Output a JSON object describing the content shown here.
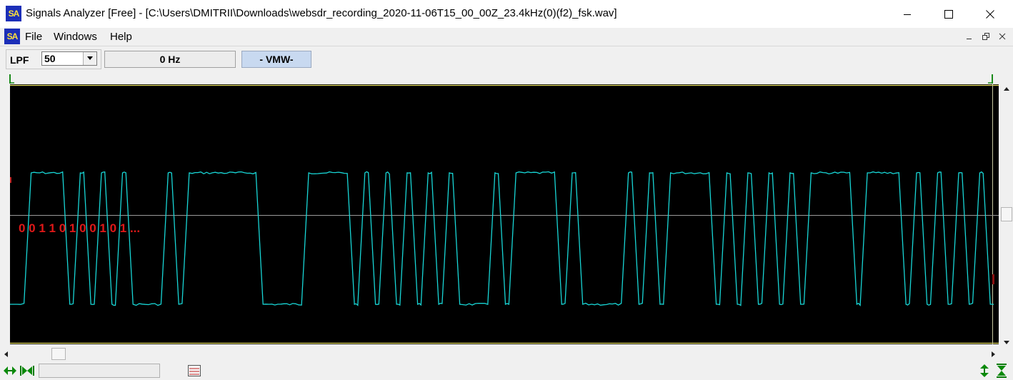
{
  "window": {
    "title": "Signals Analyzer [Free] - [C:\\Users\\DMITRII\\Downloads\\websdr_recording_2020-11-06T15_00_00Z_23.4kHz(0)(f2)_fsk.wav]",
    "logo_text": "SA"
  },
  "menu": {
    "items": [
      {
        "label": "File"
      },
      {
        "label": "Windows"
      },
      {
        "label": "Help"
      }
    ]
  },
  "toolbar": {
    "lpf_label": "LPF",
    "lpf_value": "50",
    "frequency": "0 Hz",
    "mode": "- VMW-"
  },
  "scope": {
    "annotation": "0 0  1 1 0 1 0 0 1 0 1 ...",
    "colors": {
      "background": "#000000",
      "trace": "#18d6d6",
      "frame": "#e8e060",
      "centerline": "#9a9a9a",
      "annotation": "#e01818"
    },
    "signal": {
      "type": "FSK",
      "segments": [
        [
          "lo",
          0.5
        ],
        [
          "hi",
          1.1
        ],
        [
          "lo",
          0.3
        ],
        [
          "hi",
          0.3
        ],
        [
          "lo",
          0.3
        ],
        [
          "hi",
          0.3
        ],
        [
          "lo",
          0.3
        ],
        [
          "hi",
          0.3
        ],
        [
          "lo",
          1.0
        ],
        [
          "hi",
          0.3
        ],
        [
          "lo",
          0.3
        ],
        [
          "hi",
          2.1
        ],
        [
          "lo",
          1.3
        ],
        [
          "hi",
          1.3
        ],
        [
          "lo",
          0.3
        ],
        [
          "hi",
          0.3
        ],
        [
          "lo",
          0.3
        ],
        [
          "hi",
          0.3
        ],
        [
          "lo",
          0.3
        ],
        [
          "hi",
          0.3
        ],
        [
          "lo",
          0.3
        ],
        [
          "hi",
          0.3
        ],
        [
          "lo",
          0.3
        ],
        [
          "hi",
          0.3
        ],
        [
          "lo",
          1.0
        ],
        [
          "hi",
          0.3
        ],
        [
          "lo",
          0.3
        ],
        [
          "hi",
          1.3
        ],
        [
          "lo",
          0.3
        ],
        [
          "hi",
          0.3
        ],
        [
          "lo",
          1.3
        ],
        [
          "hi",
          0.3
        ],
        [
          "lo",
          0.3
        ],
        [
          "hi",
          0.3
        ],
        [
          "lo",
          0.3
        ],
        [
          "hi",
          1.3
        ],
        [
          "lo",
          0.3
        ],
        [
          "hi",
          0.3
        ],
        [
          "lo",
          0.3
        ],
        [
          "hi",
          0.3
        ],
        [
          "lo",
          0.3
        ],
        [
          "hi",
          0.3
        ],
        [
          "lo",
          0.3
        ],
        [
          "hi",
          0.3
        ],
        [
          "lo",
          0.3
        ],
        [
          "hi",
          1.3
        ],
        [
          "lo",
          0.3
        ],
        [
          "hi",
          1.1
        ],
        [
          "lo",
          0.3
        ],
        [
          "hi",
          0.3
        ],
        [
          "lo",
          0.3
        ],
        [
          "hi",
          0.3
        ],
        [
          "lo",
          0.3
        ],
        [
          "hi",
          0.3
        ],
        [
          "lo",
          0.3
        ],
        [
          "hi",
          0.3
        ],
        [
          "lo",
          0.3
        ]
      ]
    }
  }
}
